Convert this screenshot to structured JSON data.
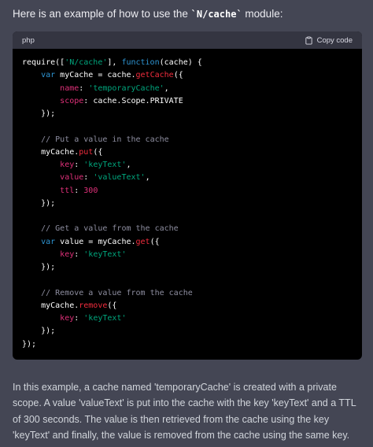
{
  "intro": {
    "prefix": "Here is an example of how to use the ",
    "module": "`N/cache`",
    "suffix": " module:"
  },
  "code_block": {
    "language": "php",
    "copy_label": "Copy code",
    "lines": [
      [
        [
          "plain",
          "require(["
        ],
        [
          "str",
          "'N/cache'"
        ],
        [
          "plain",
          "], "
        ],
        [
          "kw",
          "function"
        ],
        [
          "plain",
          "(cache) {"
        ]
      ],
      [
        [
          "plain",
          "    "
        ],
        [
          "kw",
          "var"
        ],
        [
          "plain",
          " myCache = cache."
        ],
        [
          "fn",
          "getCache"
        ],
        [
          "plain",
          "({"
        ]
      ],
      [
        [
          "plain",
          "        "
        ],
        [
          "prop",
          "name"
        ],
        [
          "plain",
          ": "
        ],
        [
          "str",
          "'temporaryCache'"
        ],
        [
          "plain",
          ","
        ]
      ],
      [
        [
          "plain",
          "        "
        ],
        [
          "prop",
          "scope"
        ],
        [
          "plain",
          ": cache.Scope.PRIVATE"
        ]
      ],
      [
        [
          "plain",
          "    });"
        ]
      ],
      [],
      [
        [
          "plain",
          "    "
        ],
        [
          "cmt",
          "// Put a value in the cache"
        ]
      ],
      [
        [
          "plain",
          "    myCache."
        ],
        [
          "fn",
          "put"
        ],
        [
          "plain",
          "({"
        ]
      ],
      [
        [
          "plain",
          "        "
        ],
        [
          "prop",
          "key"
        ],
        [
          "plain",
          ": "
        ],
        [
          "str",
          "'keyText'"
        ],
        [
          "plain",
          ","
        ]
      ],
      [
        [
          "plain",
          "        "
        ],
        [
          "prop",
          "value"
        ],
        [
          "plain",
          ": "
        ],
        [
          "str",
          "'valueText'"
        ],
        [
          "plain",
          ","
        ]
      ],
      [
        [
          "plain",
          "        "
        ],
        [
          "prop",
          "ttl"
        ],
        [
          "plain",
          ": "
        ],
        [
          "num",
          "300"
        ]
      ],
      [
        [
          "plain",
          "    });"
        ]
      ],
      [],
      [
        [
          "plain",
          "    "
        ],
        [
          "cmt",
          "// Get a value from the cache"
        ]
      ],
      [
        [
          "plain",
          "    "
        ],
        [
          "kw",
          "var"
        ],
        [
          "plain",
          " value = myCache."
        ],
        [
          "fn",
          "get"
        ],
        [
          "plain",
          "({"
        ]
      ],
      [
        [
          "plain",
          "        "
        ],
        [
          "prop",
          "key"
        ],
        [
          "plain",
          ": "
        ],
        [
          "str",
          "'keyText'"
        ]
      ],
      [
        [
          "plain",
          "    });"
        ]
      ],
      [],
      [
        [
          "plain",
          "    "
        ],
        [
          "cmt",
          "// Remove a value from the cache"
        ]
      ],
      [
        [
          "plain",
          "    myCache."
        ],
        [
          "fn",
          "remove"
        ],
        [
          "plain",
          "({"
        ]
      ],
      [
        [
          "plain",
          "        "
        ],
        [
          "prop",
          "key"
        ],
        [
          "plain",
          ": "
        ],
        [
          "str",
          "'keyText'"
        ]
      ],
      [
        [
          "plain",
          "    });"
        ]
      ],
      [
        [
          "plain",
          "});"
        ]
      ]
    ]
  },
  "explanation": "In this example, a cache named 'temporaryCache' is created with a private scope. A value 'valueText' is put into the cache with the key 'keyText' and a TTL of 300 seconds. The value is then retrieved from the cache using the key 'keyText' and finally, the value is removed from the cache using the same key.",
  "colors": {
    "background": "#444654",
    "code_background": "#000000",
    "code_header": "#343541",
    "keyword": "#2e95d3",
    "string": "#00a67d",
    "function": "#f22c3d",
    "property": "#df3079",
    "comment": "#8e8ea0"
  },
  "icons": {
    "copy": "clipboard-icon"
  }
}
